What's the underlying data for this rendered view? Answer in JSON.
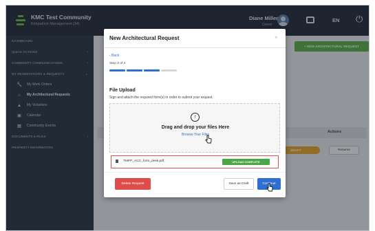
{
  "header": {
    "brand_name": "KMC Test Community",
    "brand_sub": "Kirkpatrick Management (34)",
    "user_name": "Diane Miller",
    "user_role": "Owner",
    "language": "EN"
  },
  "sidebar": {
    "sections": [
      {
        "label": "DASHBOARD"
      },
      {
        "label": "QUICK ACTIONS"
      },
      {
        "label": "COMMUNITY COMMUNICATIONS"
      },
      {
        "label": "MY RESERVATIONS & REQUESTS"
      }
    ],
    "subitems": [
      {
        "label": "My Work Orders",
        "icon": "wrench-icon"
      },
      {
        "label": "My Architectural Requests",
        "icon": "home-icon",
        "active": true
      },
      {
        "label": "My Violations",
        "icon": "warning-icon"
      },
      {
        "label": "Calendar",
        "icon": "calendar-icon"
      },
      {
        "label": "Community Events",
        "icon": "event-icon"
      }
    ],
    "bottom_sections": [
      {
        "label": "DOCUMENTS & FILES"
      },
      {
        "label": "PROPERTY INFORMATION"
      }
    ]
  },
  "page": {
    "new_request_label": "+ NEW ARCHITECTURAL REQUEST",
    "actions_header": "Actions",
    "row_status": "DRAFT",
    "row_action": "Resume"
  },
  "modal": {
    "title": "New Architectural Request",
    "close": "×",
    "back_label": "‹ Back",
    "step_text": "Step 3 of 4",
    "steps_total": 4,
    "steps_completed": 3,
    "colors": {
      "accent": "#2f6fd2",
      "inactive": "#d6d6d6",
      "success": "#4aa646",
      "danger": "#df4c4c"
    },
    "section_title": "File Upload",
    "section_desc": "Sign and attach the required form(s) in order to submit your request.",
    "drop_title": "Drag and drop your files Here",
    "browse_label": "Browse Your Files",
    "file_name": "TMPP_ACC_form_desk.pdf",
    "file_status": "UPLOAD COMPLETE",
    "delete_label": "Delete Request",
    "draft_label": "Save as Draft",
    "continue_label": "Continue"
  }
}
